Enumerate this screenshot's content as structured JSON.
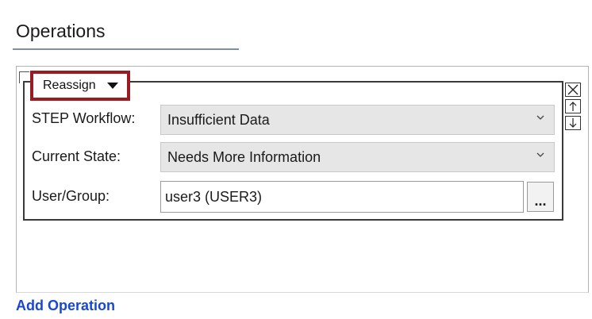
{
  "section": {
    "title": "Operations"
  },
  "operation": {
    "type_label": "Reassign",
    "fields": {
      "workflow": {
        "label": "STEP Workflow:",
        "value": "Insufficient Data"
      },
      "state": {
        "label": "Current State:",
        "value": "Needs More Information"
      },
      "user_group": {
        "label": "User/Group:",
        "value": "user3 (USER3)",
        "browse_label": "..."
      }
    },
    "controls": {
      "remove_icon": "close-icon",
      "move_up_icon": "arrow-up-icon",
      "move_down_icon": "arrow-down-icon"
    }
  },
  "footer": {
    "add_operation_label": "Add Operation"
  },
  "colors": {
    "highlight_border": "#9b1b22",
    "link": "#1846d6",
    "underline": "#8090a4"
  }
}
